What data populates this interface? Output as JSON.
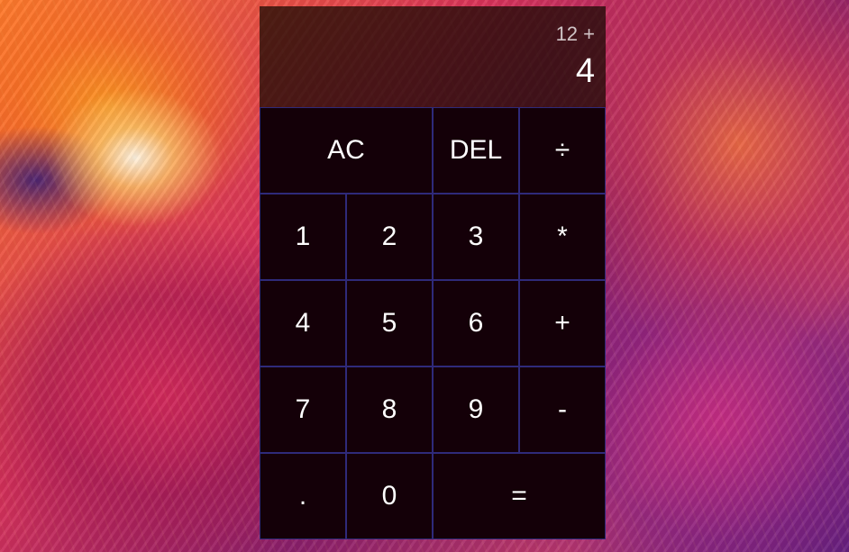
{
  "display": {
    "previous_operand": "12 +",
    "current_operand": "4"
  },
  "keys": {
    "all_clear": "AC",
    "delete": "DEL",
    "divide": "÷",
    "one": "1",
    "two": "2",
    "three": "3",
    "multiply": "*",
    "four": "4",
    "five": "5",
    "six": "6",
    "add": "+",
    "seven": "7",
    "eight": "8",
    "nine": "9",
    "subtract": "-",
    "decimal": ".",
    "zero": "0",
    "equals": "="
  }
}
